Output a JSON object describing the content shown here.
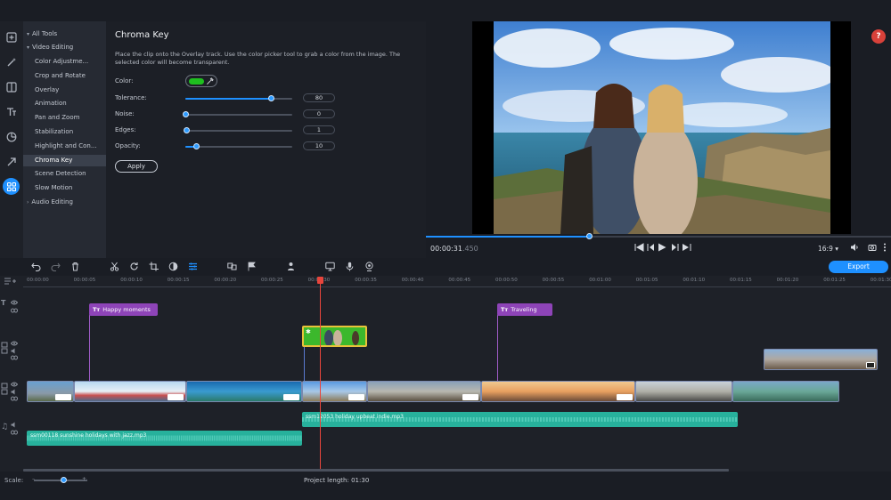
{
  "rail": {
    "icons": [
      "import-icon",
      "magic-wand-icon",
      "transitions-icon",
      "titles-icon",
      "stickers-icon",
      "arrow-icon",
      "more-tools-icon"
    ]
  },
  "tools": {
    "items": [
      {
        "label": "All Tools",
        "level": 1,
        "expanded": true
      },
      {
        "label": "Video Editing",
        "level": 1,
        "expanded": true
      },
      {
        "label": "Color Adjustme...",
        "level": 2
      },
      {
        "label": "Crop and Rotate",
        "level": 2
      },
      {
        "label": "Overlay",
        "level": 2
      },
      {
        "label": "Animation",
        "level": 2
      },
      {
        "label": "Pan and Zoom",
        "level": 2
      },
      {
        "label": "Stabilization",
        "level": 2
      },
      {
        "label": "Highlight and Con...",
        "level": 2
      },
      {
        "label": "Chroma Key",
        "level": 2,
        "selected": true
      },
      {
        "label": "Scene Detection",
        "level": 2
      },
      {
        "label": "Slow Motion",
        "level": 2
      },
      {
        "label": "Audio Editing",
        "level": 1,
        "expanded": false
      }
    ]
  },
  "panel": {
    "title": "Chroma Key",
    "description": "Place the clip onto the Overlay track. Use the color picker tool to grab a color from the image. The selected color will become transparent.",
    "color_label": "Color:",
    "color_value": "#1fc01f",
    "properties": [
      {
        "label": "Tolerance:",
        "value": "80",
        "fraction": 0.8
      },
      {
        "label": "Noise:",
        "value": "0",
        "fraction": 0.0
      },
      {
        "label": "Edges:",
        "value": "1",
        "fraction": 0.01
      },
      {
        "label": "Opacity:",
        "value": "10",
        "fraction": 0.1
      }
    ],
    "apply_label": "Apply"
  },
  "preview": {
    "help_label": "?",
    "timecode_main": "00:00:31",
    "timecode_ms": ".450",
    "progress_fraction": 0.35,
    "aspect_ratio": "16:9 ▾"
  },
  "toolbar": {
    "export_label": "Export"
  },
  "timeline": {
    "ruler_ticks": [
      "00:00:00",
      "00:00:05",
      "00:00:10",
      "00:00:15",
      "00:00:20",
      "00:00:25",
      "00:00:30",
      "00:00:35",
      "00:00:40",
      "00:00:45",
      "00:00:50",
      "00:00:55",
      "00:01:00",
      "00:01:05",
      "00:01:10",
      "00:01:15",
      "00:01:20",
      "00:01:25",
      "00:01:30"
    ],
    "titles": [
      {
        "label": "Happy moments"
      },
      {
        "label": "Traveling"
      }
    ],
    "audio": [
      {
        "label": "ssm12053 holiday upbeat indie.mp3"
      },
      {
        "label": "ssm00118 sunshine holidays with jazz.mp3"
      }
    ]
  },
  "bottom": {
    "scale_label": "Scale:",
    "project_length_label": "Project length:",
    "project_length_value": "01:30"
  }
}
